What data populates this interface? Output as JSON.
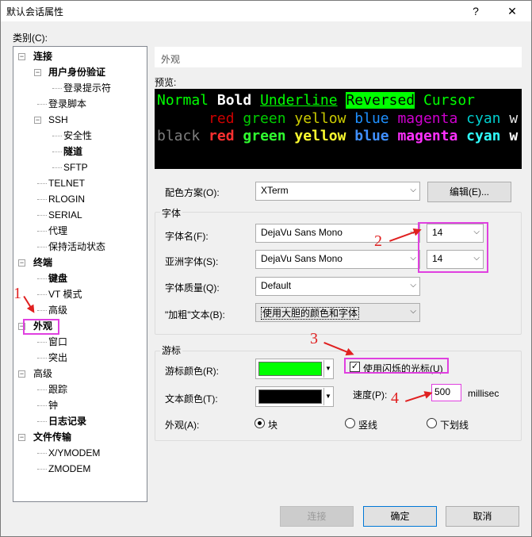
{
  "window": {
    "title": "默认会话属性",
    "help": "?",
    "close": "✕"
  },
  "category_label": "类别(C):",
  "tree": [
    {
      "label": "连接",
      "level": 0,
      "bold": true,
      "expander": "−"
    },
    {
      "label": "用户身份验证",
      "level": 1,
      "bold": true,
      "expander": "−"
    },
    {
      "label": "登录提示符",
      "level": 2,
      "bold": false,
      "expander": ""
    },
    {
      "label": "登录脚本",
      "level": 1,
      "bold": false,
      "expander": ""
    },
    {
      "label": "SSH",
      "level": 1,
      "bold": false,
      "expander": "−"
    },
    {
      "label": "安全性",
      "level": 2,
      "bold": false,
      "expander": ""
    },
    {
      "label": "隧道",
      "level": 2,
      "bold": true,
      "expander": ""
    },
    {
      "label": "SFTP",
      "level": 2,
      "bold": false,
      "expander": ""
    },
    {
      "label": "TELNET",
      "level": 1,
      "bold": false,
      "expander": ""
    },
    {
      "label": "RLOGIN",
      "level": 1,
      "bold": false,
      "expander": ""
    },
    {
      "label": "SERIAL",
      "level": 1,
      "bold": false,
      "expander": ""
    },
    {
      "label": "代理",
      "level": 1,
      "bold": false,
      "expander": ""
    },
    {
      "label": "保持活动状态",
      "level": 1,
      "bold": false,
      "expander": ""
    },
    {
      "label": "终端",
      "level": 0,
      "bold": true,
      "expander": "−"
    },
    {
      "label": "键盘",
      "level": 1,
      "bold": true,
      "expander": ""
    },
    {
      "label": "VT 模式",
      "level": 1,
      "bold": false,
      "expander": ""
    },
    {
      "label": "高级",
      "level": 1,
      "bold": false,
      "expander": ""
    },
    {
      "label": "外观",
      "level": 0,
      "bold": true,
      "expander": "−"
    },
    {
      "label": "窗口",
      "level": 1,
      "bold": false,
      "expander": ""
    },
    {
      "label": "突出",
      "level": 1,
      "bold": false,
      "expander": ""
    },
    {
      "label": "高级",
      "level": 0,
      "bold": false,
      "expander": "−"
    },
    {
      "label": "跟踪",
      "level": 1,
      "bold": false,
      "expander": ""
    },
    {
      "label": "钟",
      "level": 1,
      "bold": false,
      "expander": ""
    },
    {
      "label": "日志记录",
      "level": 1,
      "bold": true,
      "expander": ""
    },
    {
      "label": "文件传输",
      "level": 0,
      "bold": true,
      "expander": "−"
    },
    {
      "label": "X/YMODEM",
      "level": 1,
      "bold": false,
      "expander": ""
    },
    {
      "label": "ZMODEM",
      "level": 1,
      "bold": false,
      "expander": ""
    }
  ],
  "panel_header": "外观",
  "preview_label": "预览:",
  "preview": {
    "line1": [
      {
        "t": "Normal ",
        "c": "#00ff00",
        "bg": "",
        "b": false,
        "u": false
      },
      {
        "t": "Bold",
        "c": "#ffffff",
        "bg": "",
        "b": true,
        "u": false
      },
      {
        "t": " ",
        "c": "#00ff00",
        "bg": "",
        "b": false,
        "u": false
      },
      {
        "t": "Underline",
        "c": "#00ff00",
        "bg": "",
        "b": false,
        "u": true
      },
      {
        "t": " ",
        "c": "#00ff00",
        "bg": "",
        "b": false,
        "u": false
      },
      {
        "t": "Reversed",
        "c": "#000000",
        "bg": "#00ff00",
        "b": false,
        "u": false
      },
      {
        "t": " Cursor",
        "c": "#00ff00",
        "bg": "",
        "b": false,
        "u": false
      }
    ],
    "line2": [
      {
        "t": "      red ",
        "c": "#cd0000",
        "bg": "",
        "b": false,
        "u": false
      },
      {
        "t": "green ",
        "c": "#00cd00",
        "bg": "",
        "b": false,
        "u": false
      },
      {
        "t": "yellow ",
        "c": "#cdcd00",
        "bg": "",
        "b": false,
        "u": false
      },
      {
        "t": "blue ",
        "c": "#1e90ff",
        "bg": "",
        "b": false,
        "u": false
      },
      {
        "t": "magenta ",
        "c": "#cd00cd",
        "bg": "",
        "b": false,
        "u": false
      },
      {
        "t": "cyan ",
        "c": "#00cdcd",
        "bg": "",
        "b": false,
        "u": false
      },
      {
        "t": "w",
        "c": "#e5e5e5",
        "bg": "",
        "b": false,
        "u": false
      }
    ],
    "line3": [
      {
        "t": "black ",
        "c": "#7f7f7f",
        "bg": "",
        "b": false,
        "u": false
      },
      {
        "t": "red ",
        "c": "#ff3030",
        "bg": "",
        "b": true,
        "u": false
      },
      {
        "t": "green ",
        "c": "#30ff30",
        "bg": "",
        "b": true,
        "u": false
      },
      {
        "t": "yellow ",
        "c": "#ffff30",
        "bg": "",
        "b": true,
        "u": false
      },
      {
        "t": "blue ",
        "c": "#4090ff",
        "bg": "",
        "b": true,
        "u": false
      },
      {
        "t": "magenta ",
        "c": "#ff30ff",
        "bg": "",
        "b": true,
        "u": false
      },
      {
        "t": "cyan ",
        "c": "#30ffff",
        "bg": "",
        "b": true,
        "u": false
      },
      {
        "t": "w",
        "c": "#ffffff",
        "bg": "",
        "b": true,
        "u": false
      }
    ]
  },
  "scheme": {
    "label": "配色方案(O):",
    "value": "XTerm",
    "edit_button": "编辑(E)..."
  },
  "font_group": {
    "title": "字体",
    "font_name_label": "字体名(F):",
    "font_name": "DejaVu Sans Mono",
    "font_size": "14",
    "asian_font_label": "亚洲字体(S):",
    "asian_font": "DejaVu Sans Mono",
    "asian_size": "14",
    "quality_label": "字体质量(Q):",
    "quality": "Default",
    "bold_label": "\"加粗\"文本(B):",
    "bold_value": "使用大胆的颜色和字体"
  },
  "cursor_group": {
    "title": "游标",
    "cursor_color_label": "游标颜色(R):",
    "cursor_color": "#00ff00",
    "text_color_label": "文本颜色(T):",
    "text_color": "#000000",
    "blink_label": "使用闪烁的光标(U)",
    "blink_checked": true,
    "speed_label": "速度(P):",
    "speed_value": "500",
    "speed_unit": "millisec",
    "appearance_label": "外观(A):",
    "options": [
      "块",
      "竖线",
      "下划线"
    ],
    "selected": "块"
  },
  "buttons": {
    "connect": "连接",
    "ok": "确定",
    "cancel": "取消"
  },
  "annotations": [
    "1",
    "2",
    "3",
    "4"
  ],
  "colors": {
    "annotation_box": "#e040e0",
    "annotation_text": "#e02020"
  }
}
